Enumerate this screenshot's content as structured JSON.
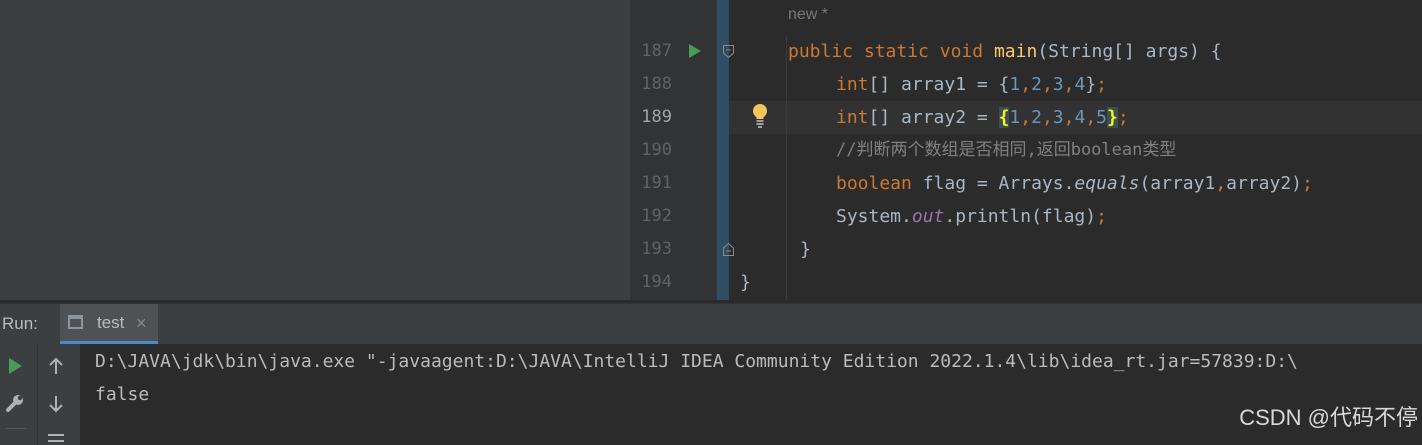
{
  "editor": {
    "hint": "new *",
    "lines": [
      {
        "n": "187"
      },
      {
        "n": "188"
      },
      {
        "n": "189"
      },
      {
        "n": "190"
      },
      {
        "n": "191"
      },
      {
        "n": "192"
      },
      {
        "n": "193"
      },
      {
        "n": "194"
      }
    ],
    "tokens": {
      "l187": [
        "public",
        "static",
        "void",
        "main",
        "(String[] args) {"
      ],
      "l188": [
        "int",
        "[] array1 = {",
        "1",
        ",",
        "2",
        ",",
        "3",
        ",",
        "4",
        "}",
        ";"
      ],
      "l189": [
        "int",
        "[] array2 = ",
        "{",
        "1",
        ",",
        "2",
        ",",
        "3",
        ",",
        "4",
        ",",
        "5",
        "}",
        ";"
      ],
      "l190": "//判断两个数组是否相同,返回boolean类型",
      "l191": [
        "boolean",
        " flag = Arrays.",
        "equals",
        "(array1",
        ",",
        "array2)",
        ";"
      ],
      "l192": [
        "System.",
        "out",
        ".println(flag)",
        ";"
      ],
      "l193": "}",
      "l194": "}"
    }
  },
  "run_panel": {
    "label": "Run:",
    "tab_label": "test",
    "tab_close": "×"
  },
  "console": {
    "lines": [
      "D:\\JAVA\\jdk\\bin\\java.exe \"-javaagent:D:\\JAVA\\IntelliJ IDEA Community Edition 2022.1.4\\lib\\idea_rt.jar=57839:D:\\",
      "false"
    ]
  },
  "watermark": "CSDN @代码不停",
  "colors": {
    "keyword": "#cc7832",
    "function": "#ffc66d",
    "number": "#6897bb",
    "comment": "#808080",
    "static_field": "#9876aa",
    "run_green": "#499c54"
  }
}
